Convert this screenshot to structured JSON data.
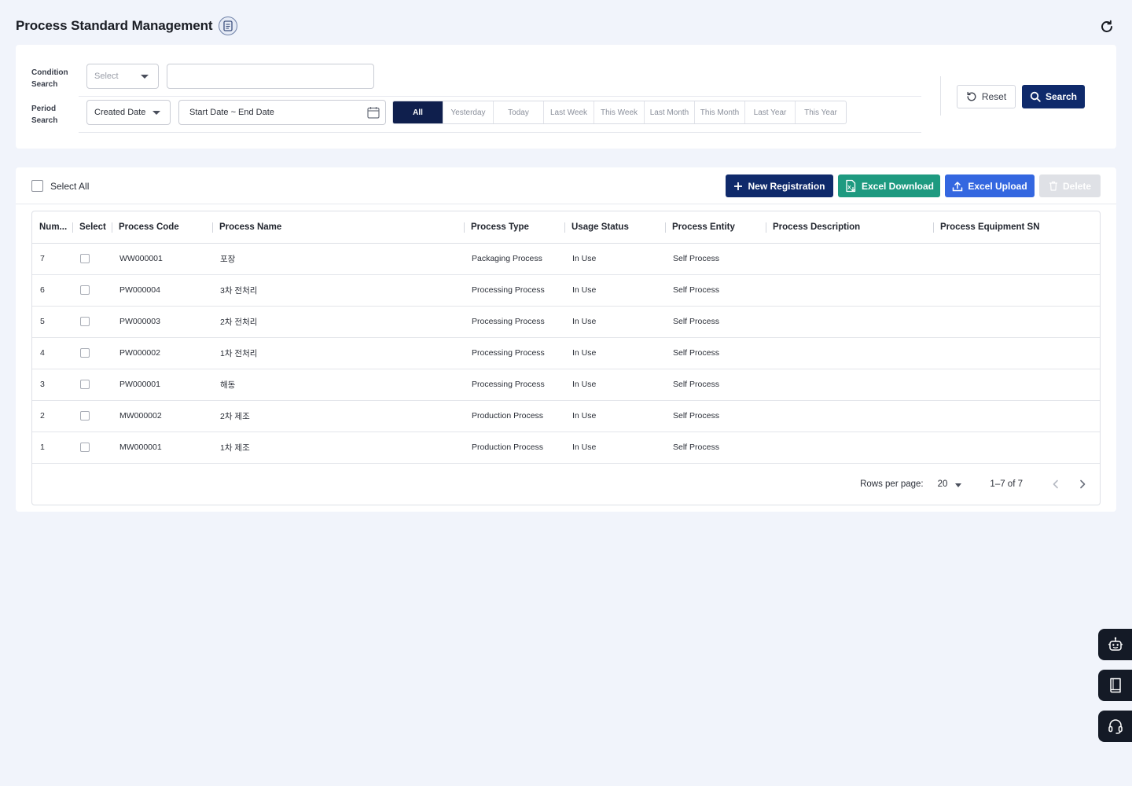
{
  "header": {
    "title": "Process Standard Management"
  },
  "search": {
    "condition_label": "Condition Search",
    "condition_select_placeholder": "Select",
    "condition_input_value": "",
    "period_label": "Period Search",
    "period_select_value": "Created Date",
    "date_range_placeholder": "Start Date ~ End Date",
    "periods": [
      "All",
      "Yesterday",
      "Today",
      "Last Week",
      "This Week",
      "Last Month",
      "This Month",
      "Last Year",
      "This Year"
    ],
    "active_period": "All",
    "reset_label": "Reset",
    "search_label": "Search"
  },
  "toolbar": {
    "select_all_label": "Select All",
    "new_label": "New Registration",
    "excel_download_label": "Excel Download",
    "excel_upload_label": "Excel Upload",
    "delete_label": "Delete"
  },
  "table": {
    "columns": [
      "Num...",
      "Select",
      "Process Code",
      "Process Name",
      "Process Type",
      "Usage Status",
      "Process Entity",
      "Process Description",
      "Process Equipment SN"
    ],
    "rows": [
      {
        "num": "7",
        "code": "WW000001",
        "name": "포장",
        "type": "Packaging Process",
        "status": "In Use",
        "entity": "Self Process",
        "description": "",
        "equipment_sn": ""
      },
      {
        "num": "6",
        "code": "PW000004",
        "name": "3차 전처리",
        "type": "Processing Process",
        "status": "In Use",
        "entity": "Self Process",
        "description": "",
        "equipment_sn": ""
      },
      {
        "num": "5",
        "code": "PW000003",
        "name": "2차 전처리",
        "type": "Processing Process",
        "status": "In Use",
        "entity": "Self Process",
        "description": "",
        "equipment_sn": ""
      },
      {
        "num": "4",
        "code": "PW000002",
        "name": "1차 전처리",
        "type": "Processing Process",
        "status": "In Use",
        "entity": "Self Process",
        "description": "",
        "equipment_sn": ""
      },
      {
        "num": "3",
        "code": "PW000001",
        "name": "해동",
        "type": "Processing Process",
        "status": "In Use",
        "entity": "Self Process",
        "description": "",
        "equipment_sn": ""
      },
      {
        "num": "2",
        "code": "MW000002",
        "name": "2차 제조",
        "type": "Production Process",
        "status": "In Use",
        "entity": "Self Process",
        "description": "",
        "equipment_sn": ""
      },
      {
        "num": "1",
        "code": "MW000001",
        "name": "1차 제조",
        "type": "Production Process",
        "status": "In Use",
        "entity": "Self Process",
        "description": "",
        "equipment_sn": ""
      }
    ]
  },
  "pagination": {
    "rows_per_page_label": "Rows per page:",
    "rows_per_page": "20",
    "range": "1–7 of 7"
  },
  "floating": {
    "icons": [
      "robot-icon",
      "book-icon",
      "headset-icon"
    ]
  },
  "colors": {
    "primary": "#0f2a6b",
    "excel_green": "#1e9a80",
    "upload_blue": "#3467e0",
    "page_bg": "#f1f4fb"
  }
}
